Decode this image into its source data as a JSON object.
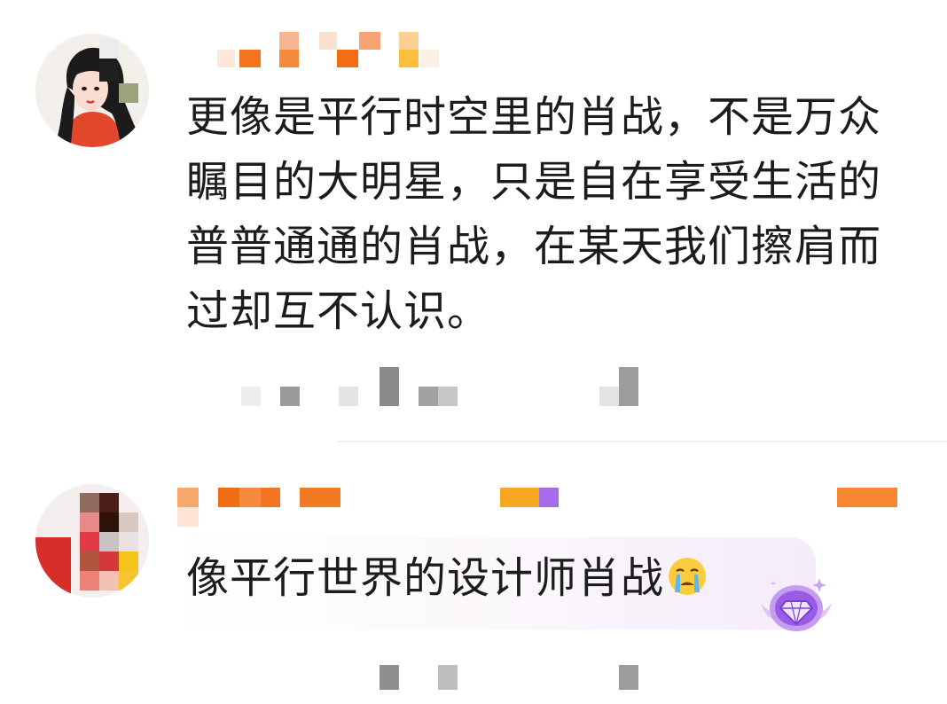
{
  "comments": [
    {
      "username": "",
      "text": "更像是平行时空里的肖战，不是万众瞩目的大明星，只是自在享受生活的普普通通的肖战，在某天我们擦肩而过却互不认识。",
      "avatar_icon": "illustrated-girl-avatar-icon",
      "meta": ""
    },
    {
      "username": "",
      "text": "像平行世界的设计师肖战",
      "emoji_icon": "crying-face-icon",
      "avatar_icon": "pixelated-avatar-icon",
      "badge_icon": "purple-diamond-badge-icon",
      "meta": ""
    }
  ],
  "colors": {
    "text": "#1c1c1c",
    "username_orange": "#f47a1f",
    "badge_purple": "#a56be8",
    "meta_gray": "#9a9a9a"
  }
}
